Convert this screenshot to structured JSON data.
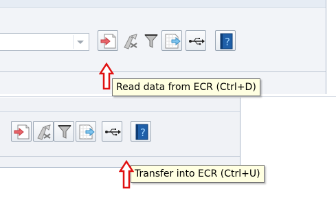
{
  "toolbar_top": {
    "tooltip": "Read data from ECR (Ctrl+D)",
    "icons": [
      "read-data-icon",
      "clear-data-icon",
      "filter-icon",
      "transfer-icon",
      "usb-icon",
      "help-icon"
    ]
  },
  "toolbar_bottom": {
    "tooltip": "Transfer into ECR (Ctrl+U)",
    "icons": [
      "read-data-icon",
      "clear-data-icon",
      "filter-icon",
      "transfer-icon",
      "usb-icon",
      "help-icon"
    ]
  },
  "colors": {
    "annotation_arrow": "#e01010",
    "tooltip_bg": "#ffffe1",
    "help_icon_blue": "#1f5fa8"
  }
}
